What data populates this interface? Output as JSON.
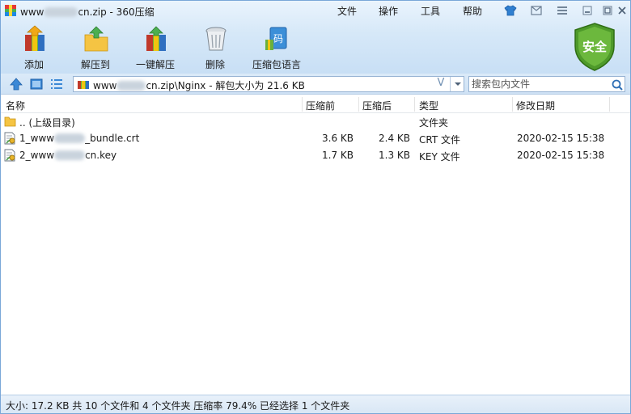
{
  "window": {
    "title_prefix": "www",
    "title_suffix": "cn.zip - 360压缩"
  },
  "menu": [
    "文件",
    "操作",
    "工具",
    "帮助"
  ],
  "toolbar": [
    {
      "label": "添加",
      "icon": "add-archive-icon"
    },
    {
      "label": "解压到",
      "icon": "extract-to-icon"
    },
    {
      "label": "一键解压",
      "icon": "one-click-extract-icon"
    },
    {
      "label": "删除",
      "icon": "delete-icon"
    },
    {
      "label": "压缩包语言",
      "icon": "archive-language-icon"
    }
  ],
  "security": {
    "label": "安全",
    "color": "#5aa02c"
  },
  "path": {
    "prefix": "www",
    "suffix": "cn.zip\\Nginx - 解包大小为 21.6 KB",
    "filter_glyph": "V"
  },
  "search": {
    "placeholder": "搜索包内文件"
  },
  "columns": {
    "name": "名称",
    "before": "压缩前",
    "after": "压缩后",
    "type": "类型",
    "modified": "修改日期"
  },
  "files": [
    {
      "name_a": ".. (上级目录)",
      "name_b": "",
      "before": "",
      "after": "",
      "type": "文件夹",
      "modified": "",
      "icon": "folder-icon"
    },
    {
      "name_a": "1_www",
      "name_b": "_bundle.crt",
      "before": "3.6 KB",
      "after": "2.4 KB",
      "type": "CRT 文件",
      "modified": "2020-02-15 15:38",
      "icon": "certificate-file-icon"
    },
    {
      "name_a": "2_www",
      "name_b": "cn.key",
      "before": "1.7 KB",
      "after": "1.3 KB",
      "type": "KEY 文件",
      "modified": "2020-02-15 15:38",
      "icon": "key-file-icon"
    }
  ],
  "status": "大小: 17.2 KB 共 10 个文件和 4 个文件夹 压缩率 79.4% 已经选择 1 个文件夹"
}
